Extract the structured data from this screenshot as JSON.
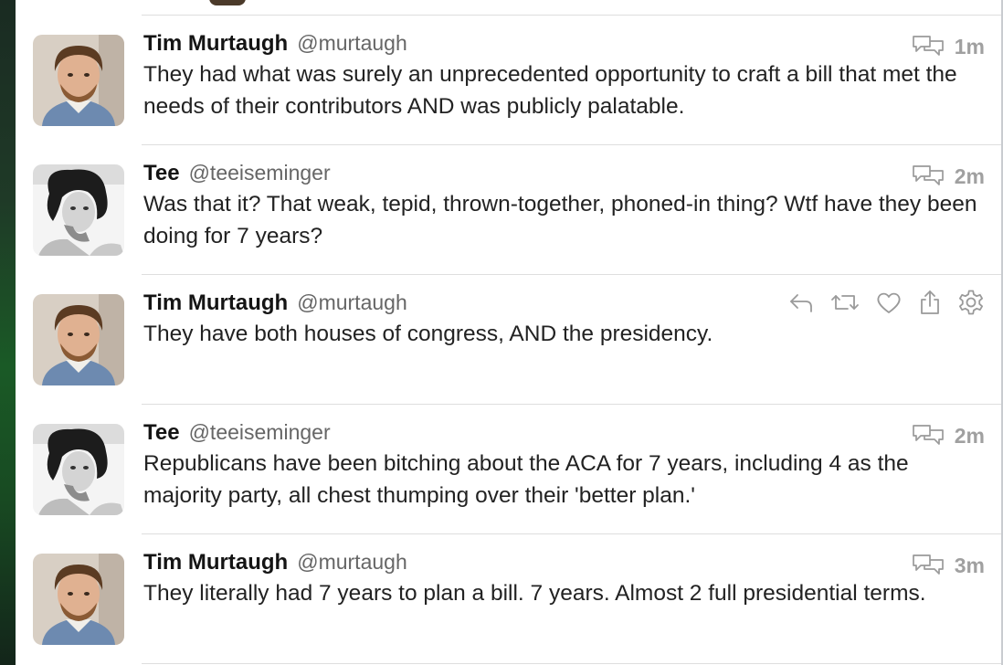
{
  "tweets": [
    {
      "name": "Tim Murtaugh",
      "handle": "@murtaugh",
      "time": "1m",
      "text": "They had what was surely an unprecedented opportunity to craft a bill that met the needs of their contributors AND was publicly palatable."
    },
    {
      "name": "Tee",
      "handle": "@teeiseminger",
      "time": "2m",
      "text": "Was that it? That weak, tepid, thrown-together, phoned-in thing? Wtf have they been doing for 7 years?"
    },
    {
      "name": "Tim Murtaugh",
      "handle": "@murtaugh",
      "text": "They have both houses of congress, AND the presidency."
    },
    {
      "name": "Tee",
      "handle": "@teeiseminger",
      "time": "2m",
      "text": "Republicans have been bitching about the ACA for 7 years, including 4 as the majority party, all chest thumping over their 'better plan.'"
    },
    {
      "name": "Tim Murtaugh",
      "handle": "@murtaugh",
      "time": "3m",
      "text": "They literally had 7 years to plan a bill. 7 years. Almost 2 full presidential terms."
    }
  ],
  "icons": {
    "conversation": "conversation-icon",
    "reply": "reply-icon",
    "retweet": "retweet-icon",
    "like": "heart-icon",
    "share": "share-icon",
    "settings": "gear-icon"
  },
  "colors": {
    "name": "#141414",
    "handle": "#666666",
    "text": "#222222",
    "meta": "#a0a0a0",
    "divider": "#dedede"
  }
}
